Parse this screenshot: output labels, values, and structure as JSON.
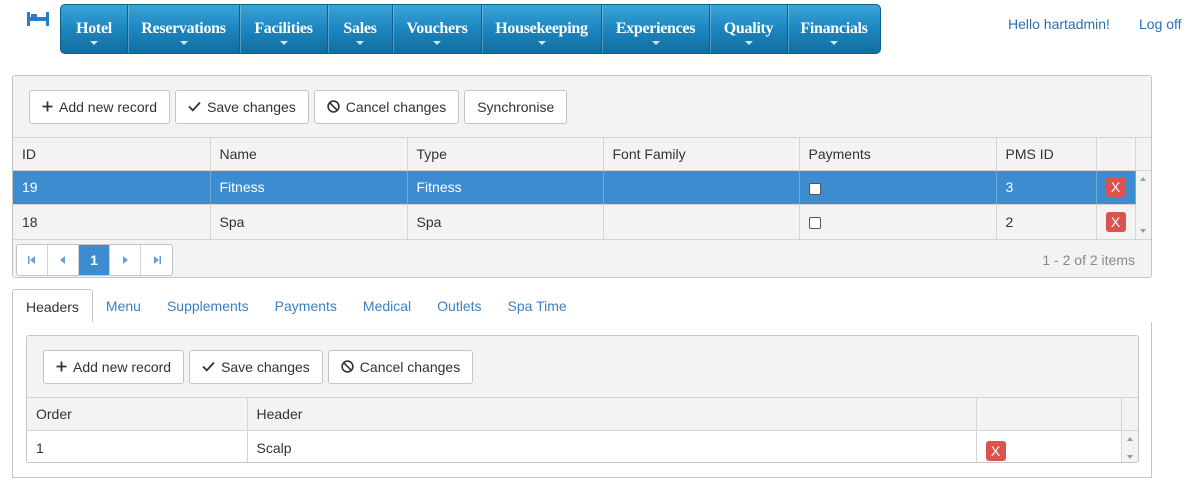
{
  "header": {
    "logo_icon": "hotel-bed-icon",
    "nav": [
      {
        "label": "Hotel"
      },
      {
        "label": "Reservations"
      },
      {
        "label": "Facilities"
      },
      {
        "label": "Sales"
      },
      {
        "label": "Vouchers"
      },
      {
        "label": "Housekeeping"
      },
      {
        "label": "Experiences"
      },
      {
        "label": "Quality"
      },
      {
        "label": "Financials"
      }
    ],
    "greeting": "Hello hartadmin!",
    "logoff": "Log off"
  },
  "facilities_grid": {
    "toolbar": {
      "add": "Add new record",
      "save": "Save changes",
      "cancel": "Cancel changes",
      "sync": "Synchronise"
    },
    "columns": [
      "ID",
      "Name",
      "Type",
      "Font Family",
      "Payments",
      "PMS ID"
    ],
    "rows": [
      {
        "id": "19",
        "name": "Fitness",
        "type": "Fitness",
        "font_family": "",
        "payments": false,
        "pms_id": "3",
        "selected": true
      },
      {
        "id": "18",
        "name": "Spa",
        "type": "Spa",
        "font_family": "",
        "payments": false,
        "pms_id": "2",
        "selected": false
      }
    ],
    "delete_label": "X",
    "pager": {
      "current_page": "1",
      "info": "1 - 2 of 2 items"
    }
  },
  "tabs": [
    {
      "label": "Headers",
      "active": true
    },
    {
      "label": "Menu"
    },
    {
      "label": "Supplements"
    },
    {
      "label": "Payments"
    },
    {
      "label": "Medical"
    },
    {
      "label": "Outlets"
    },
    {
      "label": "Spa Time"
    }
  ],
  "headers_grid": {
    "toolbar": {
      "add": "Add new record",
      "save": "Save changes",
      "cancel": "Cancel changes"
    },
    "columns": [
      "Order",
      "Header"
    ],
    "rows": [
      {
        "order": "1",
        "header": "Scalp"
      }
    ],
    "delete_label": "X"
  },
  "colors": {
    "nav_blue": "#1c86c0",
    "selection_blue": "#3d8ccf",
    "delete_red": "#d9534f",
    "link_blue": "#3d7fc4"
  }
}
